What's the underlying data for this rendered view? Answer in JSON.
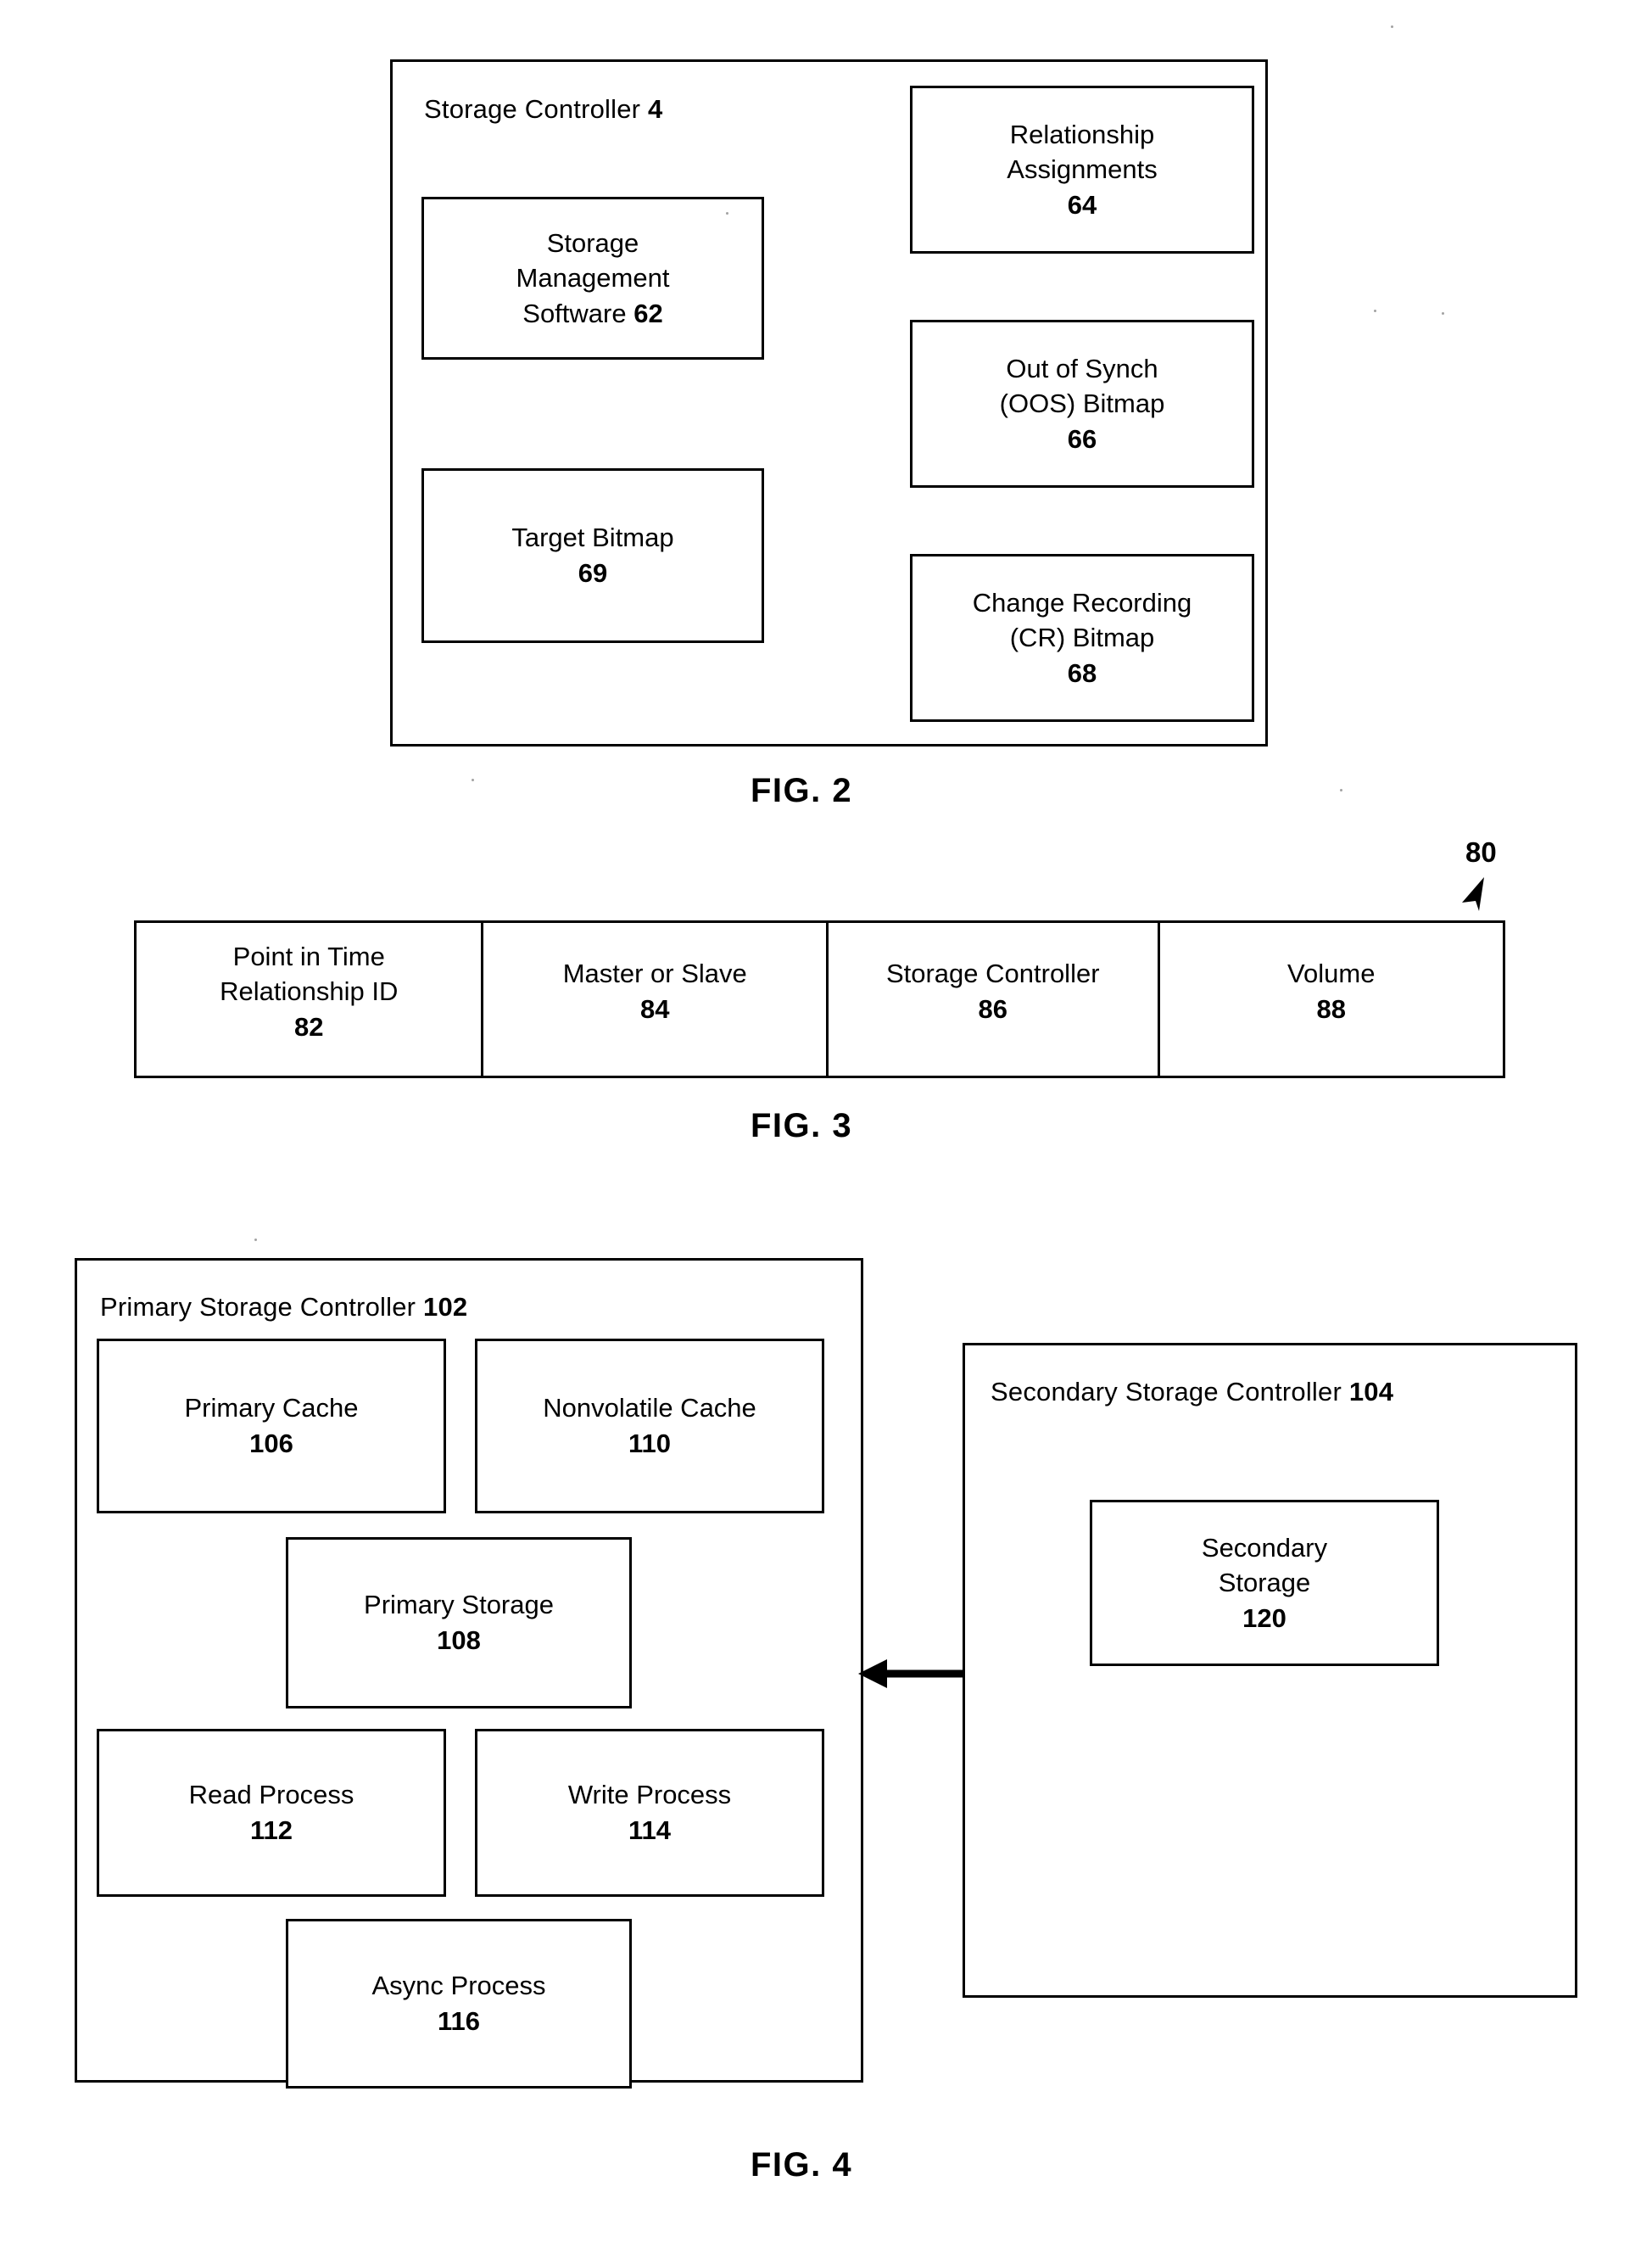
{
  "figures": [
    {
      "id": "fig2",
      "caption": "FIG. 2",
      "outer": {
        "title": "Storage Controller",
        "ref": "4"
      },
      "blocks": [
        {
          "name": "storage-management-software",
          "lines": [
            "Storage",
            "Management"
          ],
          "tail_line": "Software",
          "ref": "62",
          "ref_inline": true
        },
        {
          "name": "target-bitmap",
          "lines": [
            "Target Bitmap"
          ],
          "ref": "69",
          "ref_inline": false
        },
        {
          "name": "relationship-assignments",
          "lines": [
            "Relationship",
            "Assignments"
          ],
          "ref": "64",
          "ref_inline": false
        },
        {
          "name": "out-of-synch-bitmap",
          "lines": [
            "Out of Synch",
            "(OOS) Bitmap"
          ],
          "ref": "66",
          "ref_inline": false
        },
        {
          "name": "change-recording-bitmap",
          "lines": [
            "Change Recording",
            "(CR) Bitmap"
          ],
          "ref": "68",
          "ref_inline": false
        }
      ]
    },
    {
      "id": "fig3",
      "caption": "FIG. 3",
      "callout": "80",
      "columns": [
        {
          "name": "point-in-time-relationship-id",
          "lines": [
            "Point in Time",
            "Relationship ID"
          ],
          "ref": "82"
        },
        {
          "name": "master-or-slave",
          "lines": [
            "Master or Slave"
          ],
          "ref": "84"
        },
        {
          "name": "storage-controller",
          "lines": [
            "Storage Controller"
          ],
          "ref": "86"
        },
        {
          "name": "volume",
          "lines": [
            "Volume"
          ],
          "ref": "88"
        }
      ]
    },
    {
      "id": "fig4",
      "caption": "FIG. 4",
      "primary": {
        "title": "Primary Storage Controller",
        "ref": "102",
        "blocks": [
          {
            "name": "primary-cache",
            "lines": [
              "Primary Cache"
            ],
            "ref": "106"
          },
          {
            "name": "nonvolatile-cache",
            "lines": [
              "Nonvolatile Cache"
            ],
            "ref": "110"
          },
          {
            "name": "primary-storage",
            "lines": [
              "Primary Storage"
            ],
            "ref": "108"
          },
          {
            "name": "read-process",
            "lines": [
              "Read Process"
            ],
            "ref": "112"
          },
          {
            "name": "write-process",
            "lines": [
              "Write Process"
            ],
            "ref": "114"
          },
          {
            "name": "async-process",
            "lines": [
              "Async Process"
            ],
            "ref": "116"
          }
        ]
      },
      "secondary": {
        "title": "Secondary Storage Controller",
        "ref": "104",
        "blocks": [
          {
            "name": "secondary-storage",
            "lines": [
              "Secondary",
              "Storage"
            ],
            "ref": "120"
          }
        ]
      }
    }
  ]
}
